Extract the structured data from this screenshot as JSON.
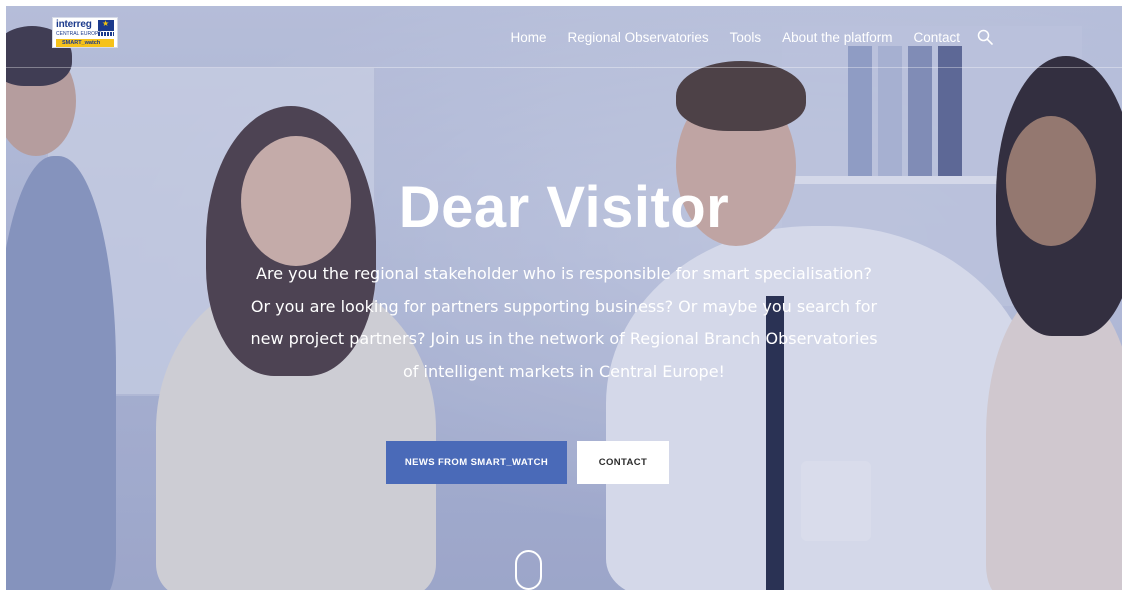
{
  "logo": {
    "line1": "interreg",
    "line2": "CENTRAL EUROPE",
    "tag": "SMART_watch"
  },
  "nav": {
    "items": [
      {
        "label": "Home"
      },
      {
        "label": "Regional Observatories"
      },
      {
        "label": "Tools"
      },
      {
        "label": "About the platform"
      },
      {
        "label": "Contact"
      }
    ],
    "search_icon": "search-icon"
  },
  "hero": {
    "title": "Dear Visitor",
    "text": "Are you the regional stakeholder who is responsible for smart specialisation? Or you are looking for partners supporting business? Or maybe you search for new project partners? Join us in the network of Regional Branch Observatories of intelligent markets in Central Europe!",
    "buttons": {
      "news": "NEWS FROM SMART_WATCH",
      "contact": "CONTACT"
    }
  },
  "colors": {
    "primary_button": "#4a6ab8",
    "overlay": "#6070b2"
  }
}
